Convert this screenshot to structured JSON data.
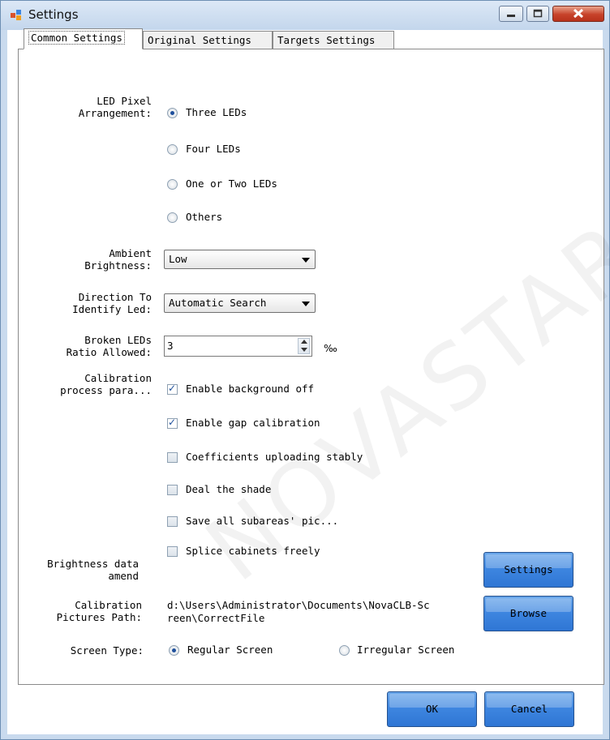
{
  "window": {
    "title": "Settings"
  },
  "tabs": [
    {
      "label": "Common Settings"
    },
    {
      "label": "Original Settings"
    },
    {
      "label": "Targets Settings"
    }
  ],
  "led_pixel": {
    "label": "LED Pixel\nArrangement:",
    "options": [
      "Three LEDs",
      "Four LEDs",
      "One or Two LEDs",
      "Others"
    ],
    "selected": "Three LEDs"
  },
  "ambient": {
    "label": "Ambient\nBrightness:",
    "value": "Low"
  },
  "direction": {
    "label": "Direction To\nIdentify Led:",
    "value": "Automatic Search"
  },
  "broken": {
    "label": "Broken LEDs\nRatio Allowed:",
    "value": "3",
    "unit": "‰"
  },
  "calibration": {
    "label": "Calibration\nprocess para...",
    "checks": [
      {
        "label": "Enable background off",
        "checked": true
      },
      {
        "label": "Enable gap calibration",
        "checked": true
      },
      {
        "label": "Coefficients uploading stably",
        "checked": false
      },
      {
        "label": "Deal the shade",
        "checked": false
      },
      {
        "label": "Save all subareas' pic...",
        "checked": false
      },
      {
        "label": "Splice cabinets freely",
        "checked": false
      }
    ]
  },
  "brightness_amend": {
    "label": "Brightness data\namend",
    "button": "Settings"
  },
  "pictures_path": {
    "label": "Calibration\nPictures Path:",
    "value": "d:\\Users\\Administrator\\Documents\\NovaCLB-Sc\nreen\\CorrectFile",
    "button": "Browse"
  },
  "screen_type": {
    "label": "Screen Type:",
    "options": [
      "Regular Screen",
      "Irregular Screen"
    ],
    "selected": "Regular Screen"
  },
  "footer": {
    "ok": "OK",
    "cancel": "Cancel"
  },
  "watermark": "NOVASTAR TECH"
}
